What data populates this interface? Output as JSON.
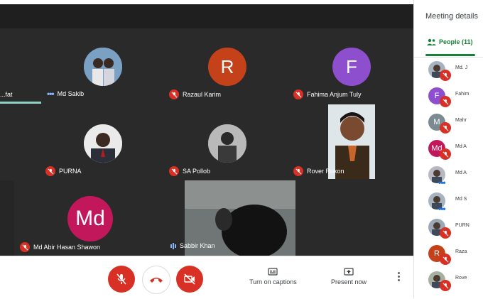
{
  "participants": [
    {
      "name": "...fat",
      "status": "none"
    },
    {
      "name": "Md Sakib",
      "status": "speaking-dots"
    },
    {
      "name": "Razaul Karim",
      "initial": "R",
      "status": "muted"
    },
    {
      "name": "Fahima Anjum Tuly",
      "initial": "F",
      "status": "muted"
    },
    {
      "name": "PURNA",
      "status": "muted"
    },
    {
      "name": "SA Pollob",
      "status": "muted"
    },
    {
      "name": "Rover Rukon",
      "status": "muted"
    },
    {
      "name": "Md Abir Hasan Shawon",
      "initial": "Md",
      "status": "muted"
    },
    {
      "name": "Sabbir Khan",
      "status": "audio-wave"
    }
  ],
  "colors": {
    "razaul": "#c5411a",
    "fahima": "#8e4fcf",
    "mdabir": "#c2185b",
    "muted_red": "#d93025",
    "panel_green": "#188038",
    "m_gray": "#7a8b92"
  },
  "controls": {
    "captions_label": "Turn on captions",
    "present_label": "Present now"
  },
  "panel": {
    "title": "Meeting details",
    "people_tab": "People (11)",
    "people": [
      {
        "name": "Md. J",
        "type": "photo",
        "status": "muted"
      },
      {
        "name": "Fahim",
        "type": "initial",
        "initial": "F",
        "color": "#8e4fcf",
        "status": "muted"
      },
      {
        "name": "Mahr",
        "type": "initial",
        "initial": "M",
        "color": "#7a8b92",
        "status": "muted"
      },
      {
        "name": "Md A",
        "type": "initial",
        "initial": "Md",
        "color": "#c2185b",
        "status": "muted"
      },
      {
        "name": "Md A",
        "type": "photo",
        "status": "dots"
      },
      {
        "name": "Md S",
        "type": "photo",
        "status": "dots"
      },
      {
        "name": "PURN",
        "type": "photo",
        "status": "muted"
      },
      {
        "name": "Raza",
        "type": "initial",
        "initial": "R",
        "color": "#c5411a",
        "status": "muted"
      },
      {
        "name": "Rove",
        "type": "photo",
        "status": "muted"
      }
    ]
  }
}
